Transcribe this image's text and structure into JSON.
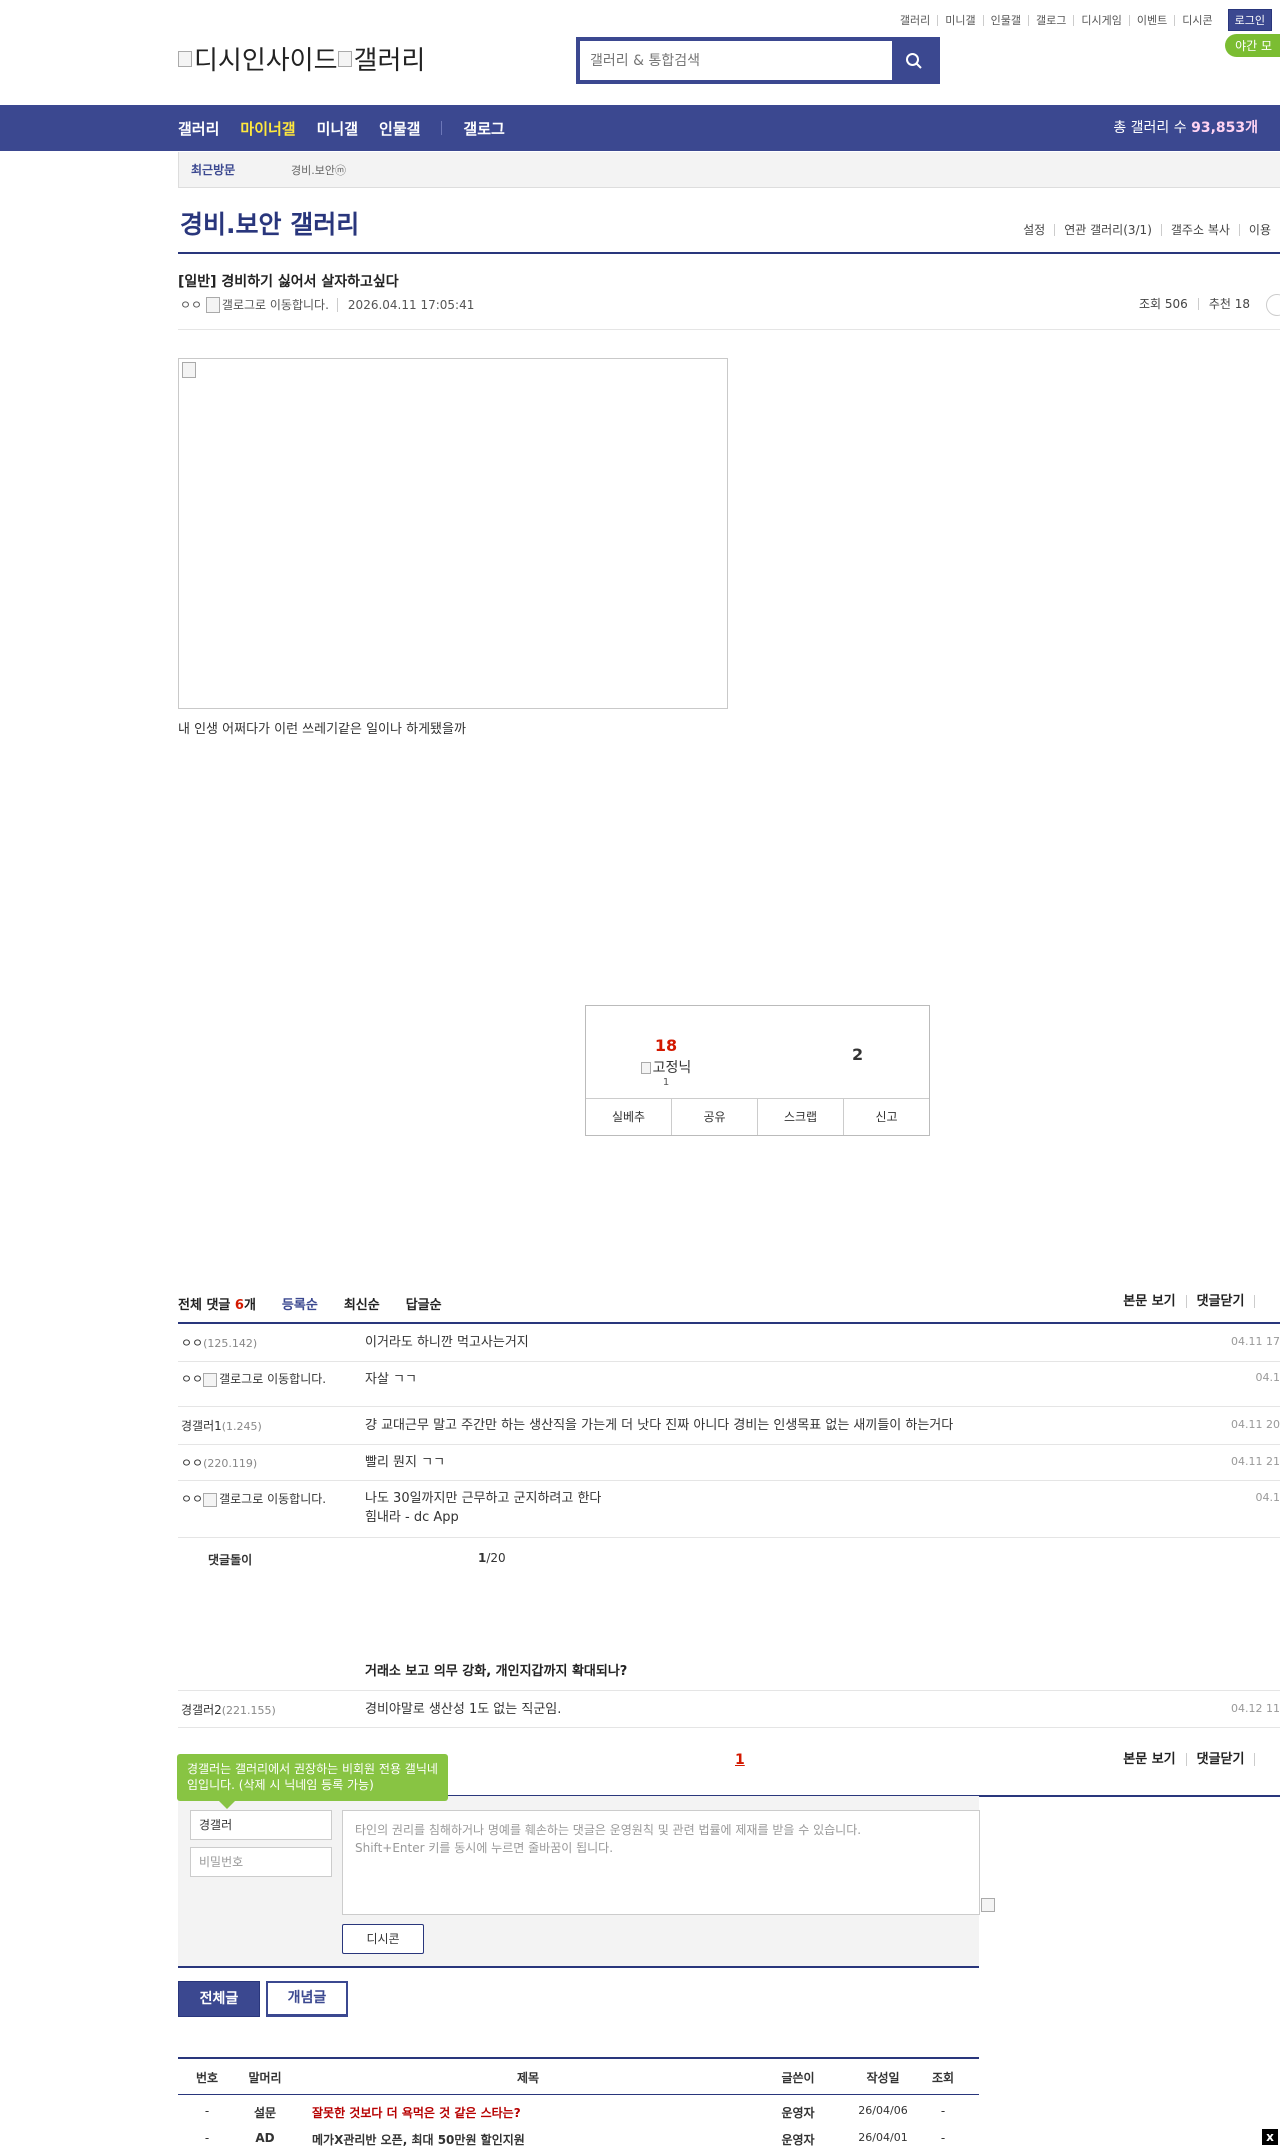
{
  "util": [
    "갤러리",
    "미니갤",
    "인물갤",
    "갤로그",
    "디시게임",
    "이벤트",
    "디시콘"
  ],
  "util_login": "로그인",
  "night_mode": "야간 모",
  "logo": {
    "main": "디시인사이드",
    "sub": "갤러리"
  },
  "search": {
    "placeholder": "갤러리 & 통합검색"
  },
  "gnb": {
    "items": [
      "갤러리",
      "마이너갤",
      "미니갤",
      "인물갤"
    ],
    "gallog": "갤로그",
    "total_label": "총 갤러리 수",
    "total_value": "93,853개"
  },
  "recent": {
    "title": "최근방문",
    "item": "경비.보안ⓜ"
  },
  "gallery": {
    "title": "경비.보안 갤러리",
    "menu": [
      "설정",
      "연관 갤러리(3/1)",
      "갤주소 복사",
      "이용"
    ]
  },
  "post": {
    "title": "[일반] 경비하기 싫어서 살자하고싶다",
    "author": "ㅇㅇ",
    "author_icon_alt": "갤로그로 이동합니다.",
    "date": "2026.04.11 17:05:41",
    "views": "조회 506",
    "recommend": "추천 18",
    "body": "내 인생 어쩌다가 이런 쓰레기같은 일이나 하게됐을까"
  },
  "recommend_box": {
    "up": "18",
    "fixed_alt": "고정닉",
    "fixed_count": "1",
    "down": "2",
    "buttons": [
      "실베추",
      "공유",
      "스크랩",
      "신고"
    ]
  },
  "comments": {
    "total_label": "전체 댓글",
    "total_num": "6",
    "total_unit": "개",
    "sort": [
      "등록순",
      "최신순",
      "답글순"
    ],
    "right": [
      "본문 보기",
      "댓글닫기"
    ],
    "rows": [
      {
        "nick": "ㅇㅇ",
        "ip": "(125.142)",
        "text": "이거라도 하니깐 먹고사는거지",
        "time": "04.11 17"
      },
      {
        "nick": "ㅇㅇ",
        "ip": "갤로그로 이동합니다.",
        "text": "자살 ㄱㄱ",
        "time": "04.1"
      },
      {
        "nick": "경갤러1",
        "ip": "(1.245)",
        "text": "걍 교대근무 말고 주간만 하는 생산직을 가는게 더 낫다 진짜 아니다 경비는 인생목표 없는 새끼들이 하는거다",
        "time": "04.11 20"
      },
      {
        "nick": "ㅇㅇ",
        "ip": "(220.119)",
        "text": "빨리 뭔지 ㄱㄱ",
        "time": "04.11 21"
      },
      {
        "nick": "ㅇㅇ",
        "ip": "갤로그로 이동합니다.",
        "text": "나도 30일까지만 근무하고 군지하려고 한다",
        "text2": "힘내라 - dc App",
        "time": "04.1"
      }
    ],
    "reply_bot": "댓글돌이",
    "reply_page": "1",
    "reply_total": "/20",
    "best_title": "거래소 보고 의무 강화, 개인지갑까지 확대되나?",
    "best_row": {
      "nick": "경갤러2",
      "ip": "(221.155)",
      "text": "경비야말로 생산성 1도 없는 직군임.",
      "time": "04.12 11"
    },
    "page": "1"
  },
  "write": {
    "tooltip": "경갤러는 갤러리에서 권장하는 비회원 전용 갤닉네임입니다. (삭제 시 닉네임 등록 가능)",
    "nick_value": "경갤러",
    "password_placeholder": "비밀번호",
    "area_line1": "타인의 권리를 침해하거나 명예를 훼손하는 댓글은 운영원칙 및 관련 법률에 제재를 받을 수 있습니다.",
    "area_line2": "Shift+Enter 키를 동시에 누르면 줄바꿈이 됩니다.",
    "dccon": "디시콘"
  },
  "list_buttons": {
    "all": "전체글",
    "best": "개념글"
  },
  "list": {
    "headers": [
      "번호",
      "말머리",
      "제목",
      "글쓴이",
      "작성일",
      "조회"
    ],
    "rows": [
      {
        "no": "-",
        "head": "설문",
        "title": "잘못한 것보다 더 욕먹은 것 같은 스타는?",
        "writer": "운영자",
        "date": "26/04/06",
        "view": "-"
      },
      {
        "no": "-",
        "head": "AD",
        "title": "메가X관리반 오픈, 최대 50만원 할인지원",
        "writer": "운영자",
        "date": "26/04/01",
        "view": "-"
      }
    ]
  },
  "colors": {
    "brand": "#3b4890",
    "brand_dark": "#29367c",
    "accent": "#d31900",
    "green": "#88c443"
  }
}
